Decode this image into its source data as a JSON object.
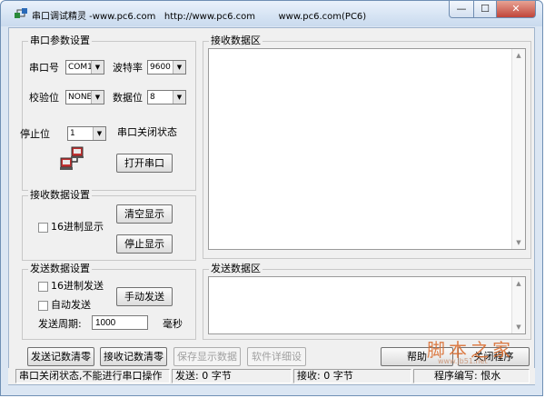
{
  "window": {
    "title": "串口调试精灵 -www.pc6.com   http://www.pc6.com        www.pc6.com(PC6)",
    "minimize_glyph": "—",
    "maximize_glyph": "☐",
    "close_glyph": "✕"
  },
  "serial_settings": {
    "group_label": "串口参数设置",
    "port_label": "串口号",
    "port_value": "COM1",
    "baud_label": "波特率",
    "baud_value": "9600",
    "parity_label": "校验位",
    "parity_value": "NONE",
    "databits_label": "数据位",
    "databits_value": "8",
    "stopbits_label": "停止位",
    "stopbits_value": "1",
    "status_text": "串口关闭状态",
    "open_button": "打开串口",
    "port_icon": "serial-port-icon"
  },
  "receive_settings": {
    "group_label": "接收数据设置",
    "hex_display_label": "16进制显示",
    "clear_button": "清空显示",
    "stop_button": "停止显示"
  },
  "send_settings": {
    "group_label": "发送数据设置",
    "hex_send_label": "16进制发送",
    "auto_send_label": "自动发送",
    "manual_send_button": "手动发送",
    "period_label": "发送周期:",
    "period_value": "1000",
    "period_unit": "毫秒"
  },
  "receive_area": {
    "label": "接收数据区"
  },
  "send_area": {
    "label": "发送数据区"
  },
  "bottom_buttons": {
    "clear_send_count": "发送记数清零",
    "clear_recv_count": "接收记数清零",
    "save_display": "保存显示数据",
    "software_settings": "软件详细设置",
    "help": "帮助",
    "close_program": "关闭程序"
  },
  "statusbar": {
    "state": "串口关闭状态,不能进行串口操作",
    "sent": "发送: 0 字节",
    "received": "接收: 0 字节",
    "author": "程序编写: 恨水"
  },
  "watermark": {
    "text": "脚本之家",
    "url": "www.jb51.net"
  }
}
